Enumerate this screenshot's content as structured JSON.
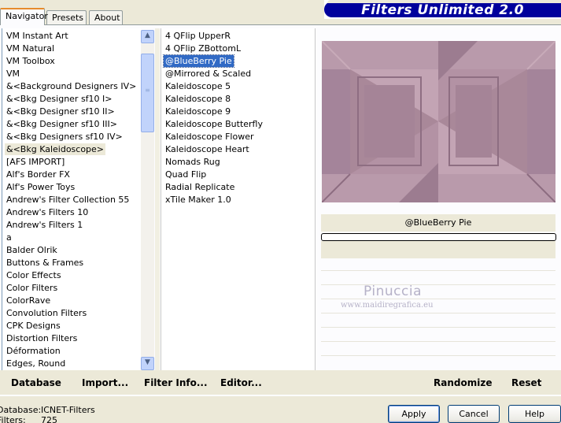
{
  "tabs": [
    {
      "label": "Navigator",
      "active": true
    },
    {
      "label": "Presets",
      "active": false
    },
    {
      "label": "About",
      "active": false
    }
  ],
  "banner": {
    "title": "Filters Unlimited 2.0"
  },
  "categories": {
    "items": [
      "VM Instant Art",
      "VM Natural",
      "VM Toolbox",
      "VM",
      "&<Background Designers IV>",
      "&<Bkg Designer sf10 I>",
      "&<Bkg Designer sf10 II>",
      "&<Bkg Designer sf10 III>",
      "&<Bkg Designers sf10 IV>",
      "&<Bkg Kaleidoscope>",
      "[AFS IMPORT]",
      "Alf's Border FX",
      "Alf's Power Toys",
      "Andrew's Filter Collection 55",
      "Andrew's Filters 10",
      "Andrew's Filters 1",
      "a",
      "Balder Olrik",
      "Buttons & Frames",
      "Color Effects",
      "Color Filters",
      "ColorRave",
      "Convolution Filters",
      "CPK Designs",
      "Distortion Filters",
      "Déformation",
      "Edges, Round"
    ],
    "selected": "&<Bkg Kaleidoscope>"
  },
  "filters": {
    "items": [
      "4 QFlip UpperR",
      "4 QFlip ZBottomL",
      "@BlueBerry Pie",
      "@Mirrored & Scaled",
      "Kaleidoscope 5",
      "Kaleidoscope 8",
      "Kaleidoscope 9",
      "Kaleidoscope Butterfly",
      "Kaleidoscope Flower",
      "Kaleidoscope Heart",
      "Nomads Rug",
      "Quad Flip",
      "Radial Replicate",
      "xTile Maker 1.0"
    ],
    "selected": "@BlueBerry Pie"
  },
  "preview": {
    "filter_name": "@BlueBerry Pie",
    "colors": {
      "base": "#a98899",
      "light": "#c4a6b5",
      "dark": "#8a6a7d",
      "mid": "#b595a6"
    }
  },
  "watermark": {
    "title": "Pinuccia",
    "url": "www.maidiregrafica.eu"
  },
  "toolbar": {
    "database": "Database",
    "import": "Import...",
    "filter_info": "Filter Info...",
    "editor": "Editor...",
    "randomize": "Randomize",
    "reset": "Reset"
  },
  "status": {
    "database_label": "Database:",
    "database_value": "ICNET-Filters",
    "filters_label": "Filters:",
    "filters_value": "725"
  },
  "buttons": {
    "apply": "Apply",
    "cancel": "Cancel",
    "help": "Help"
  },
  "scrollbar": {
    "up_icon": "arrow-up-icon",
    "down_icon": "arrow-down-icon"
  }
}
